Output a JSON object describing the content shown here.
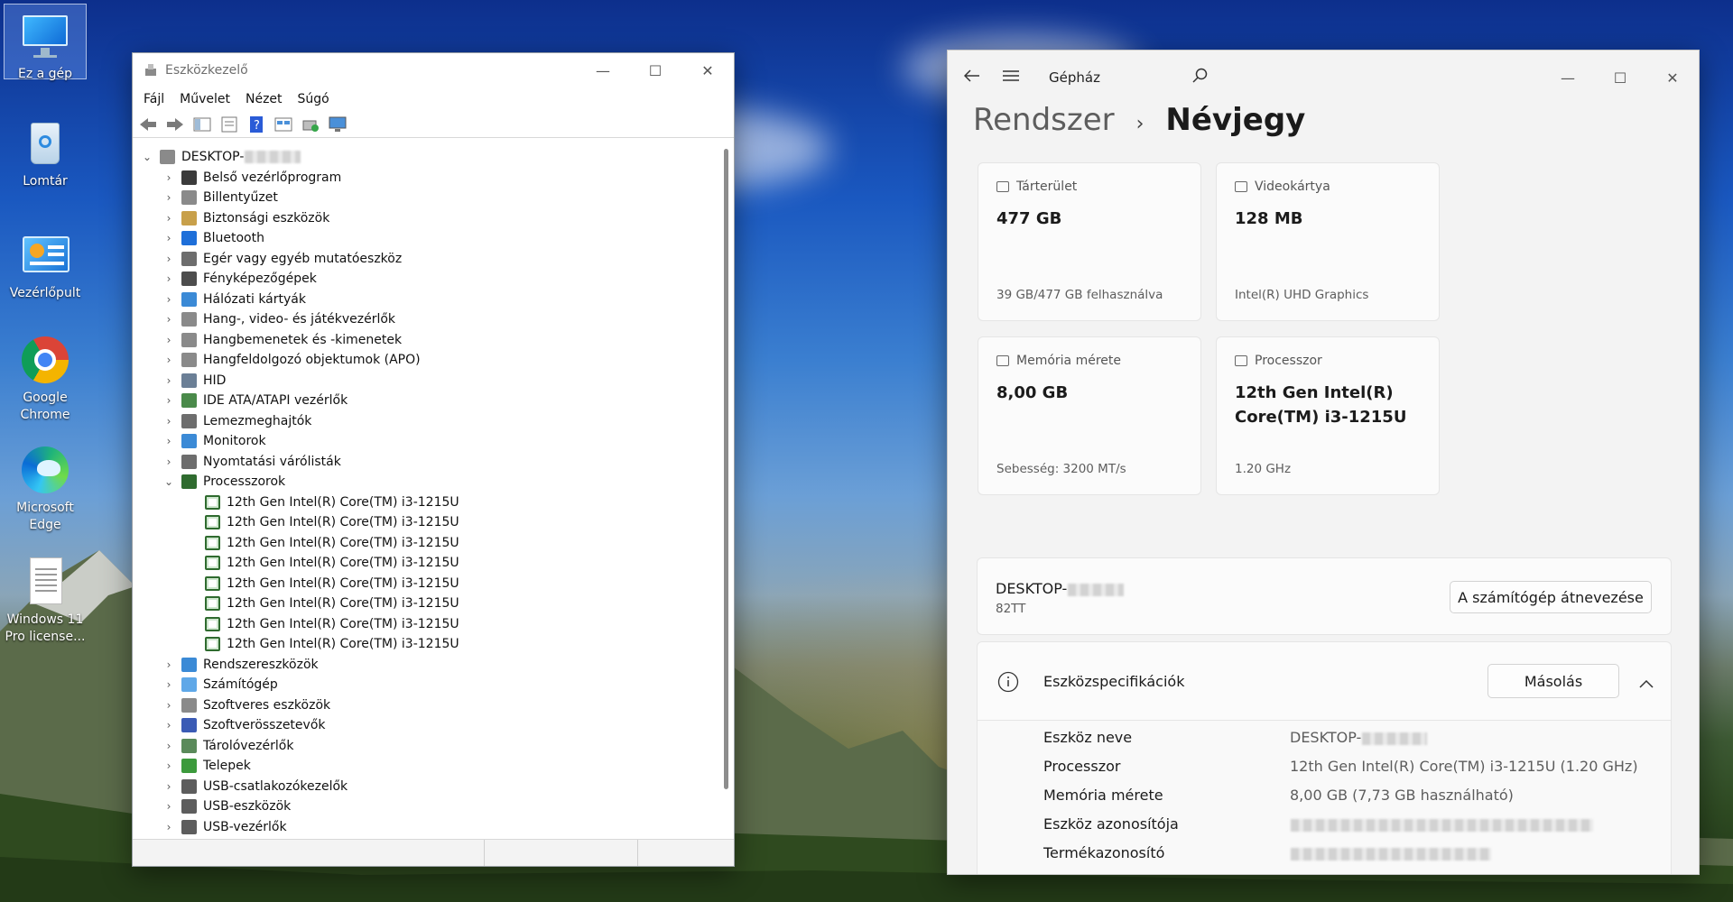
{
  "desktop": {
    "icons": [
      {
        "label": "Ez a gép"
      },
      {
        "label": "Lomtár"
      },
      {
        "label": "Vezérlőpult"
      },
      {
        "label": "Google Chrome"
      },
      {
        "label": "Microsoft Edge"
      },
      {
        "label": "Windows 11 Pro license..."
      }
    ]
  },
  "devmgr": {
    "title": "Eszközkezelő",
    "menu": [
      "Fájl",
      "Művelet",
      "Nézet",
      "Súgó"
    ],
    "root": "DESKTOP-",
    "categories": [
      "Belső vezérlőprogram",
      "Billentyűzet",
      "Biztonsági eszközök",
      "Bluetooth",
      "Egér vagy egyéb mutatóeszköz",
      "Fényképezőgépek",
      "Hálózati kártyák",
      "Hang-, video- és játékvezérlők",
      "Hangbemenetek és -kimenetek",
      "Hangfeldolgozó objektumok (APO)",
      "HID",
      "IDE ATA/ATAPI vezérlők",
      "Lemezmeghajtók",
      "Monitorok",
      "Nyomtatási várólisták",
      "Processzorok"
    ],
    "processors": [
      "12th Gen Intel(R) Core(TM) i3-1215U",
      "12th Gen Intel(R) Core(TM) i3-1215U",
      "12th Gen Intel(R) Core(TM) i3-1215U",
      "12th Gen Intel(R) Core(TM) i3-1215U",
      "12th Gen Intel(R) Core(TM) i3-1215U",
      "12th Gen Intel(R) Core(TM) i3-1215U",
      "12th Gen Intel(R) Core(TM) i3-1215U",
      "12th Gen Intel(R) Core(TM) i3-1215U"
    ],
    "categories_after": [
      "Rendszereszközök",
      "Számítógép",
      "Szoftveres eszközök",
      "Szoftverösszetevők",
      "Tárolóvezérlők",
      "Telepek",
      "USB-csatlakozókezelők",
      "USB-eszközök",
      "USB-vezérlők"
    ]
  },
  "settings": {
    "title": "Gépház",
    "breadcrumb_parent": "Rendszer",
    "breadcrumb_current": "Névjegy",
    "cards": {
      "storage": {
        "label": "Tárterület",
        "value": "477 GB",
        "sub": "39 GB/477 GB felhasználva"
      },
      "gpu": {
        "label": "Videokártya",
        "value": "128 MB",
        "sub": "Intel(R) UHD Graphics"
      },
      "memory": {
        "label": "Memória mérete",
        "value": "8,00 GB",
        "sub": "Sebesség: 3200 MT/s"
      },
      "cpu": {
        "label": "Processzor",
        "value": "12th Gen Intel(R) Core(TM) i3-1215U",
        "sub": "1.20 GHz"
      }
    },
    "device": {
      "name": "DESKTOP-",
      "model": "82TT",
      "rename_button": "A számítógép átnevezése"
    },
    "specs": {
      "title": "Eszközspecifikációk",
      "copy_button": "Másolás",
      "rows": [
        {
          "key": "Eszköz neve",
          "value": "DESKTOP-"
        },
        {
          "key": "Processzor",
          "value": "12th Gen Intel(R) Core(TM) i3-1215U (1.20 GHz)"
        },
        {
          "key": "Memória mérete",
          "value": "8,00 GB (7,73 GB használható)"
        },
        {
          "key": "Eszköz azonosítója",
          "value": ""
        },
        {
          "key": "Termékazonosító",
          "value": ""
        }
      ]
    }
  },
  "colors": {
    "cpu_icon": "#2f6b2f",
    "accent": "#0067c0"
  }
}
